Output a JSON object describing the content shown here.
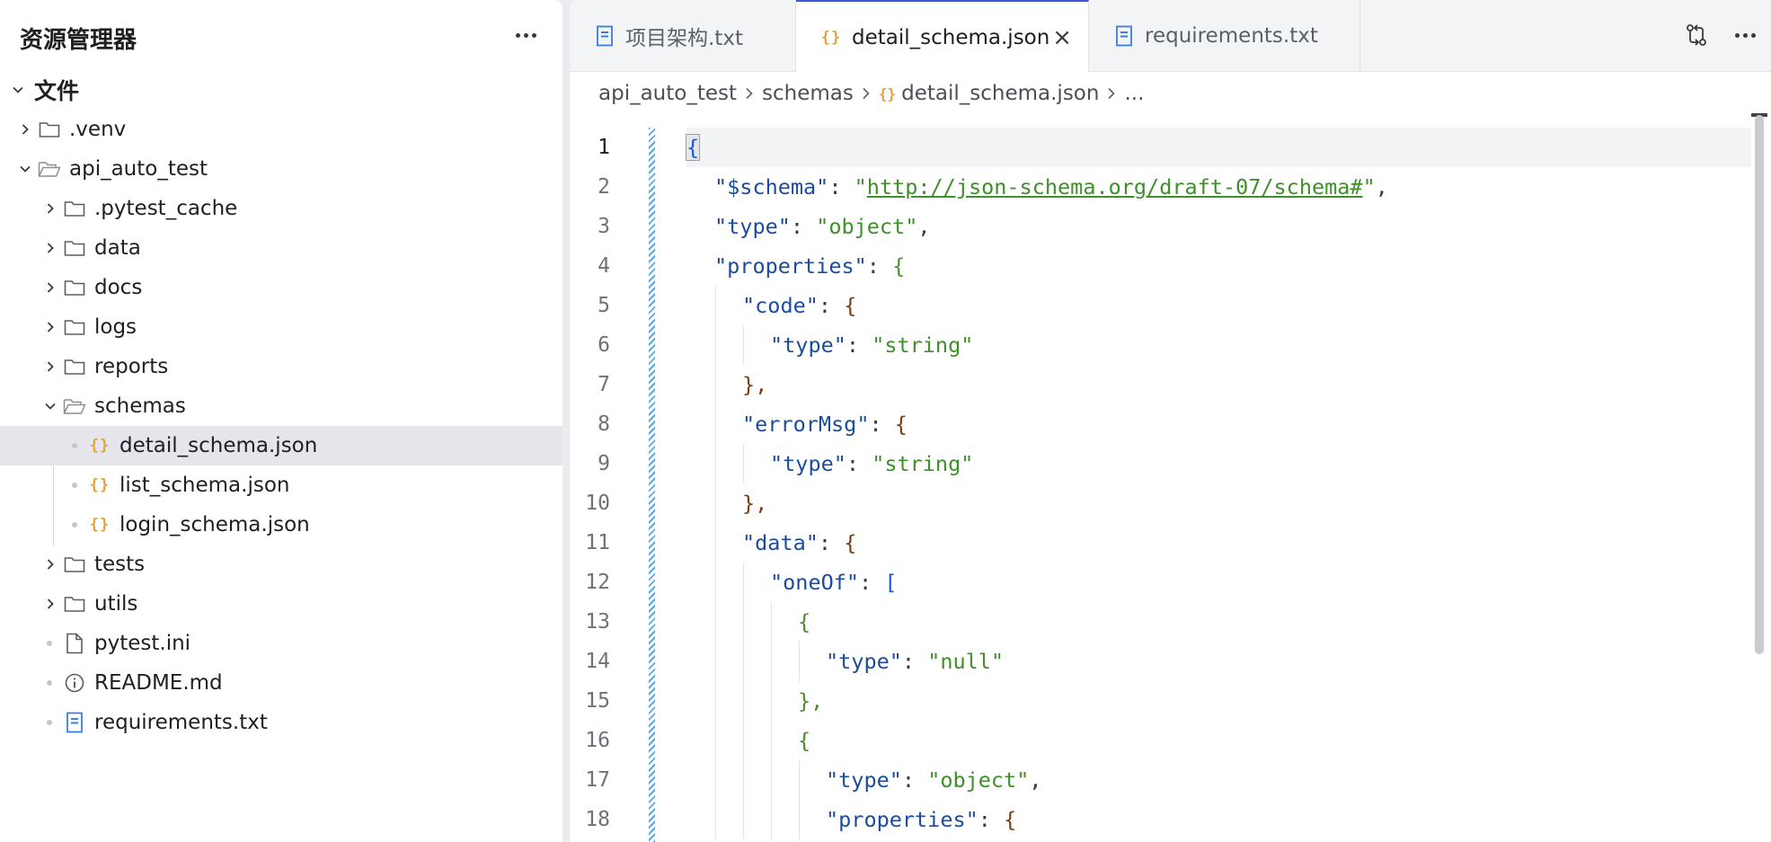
{
  "sidebar": {
    "title": "资源管理器",
    "root_label": "文件",
    "items": [
      {
        "label": ".venv",
        "type": "folder"
      },
      {
        "label": "api_auto_test",
        "type": "folder-open"
      },
      {
        "label": ".pytest_cache",
        "type": "folder"
      },
      {
        "label": "data",
        "type": "folder"
      },
      {
        "label": "docs",
        "type": "folder"
      },
      {
        "label": "logs",
        "type": "folder"
      },
      {
        "label": "reports",
        "type": "folder"
      },
      {
        "label": "schemas",
        "type": "folder-open"
      },
      {
        "label": "detail_schema.json",
        "type": "json",
        "selected": true
      },
      {
        "label": "list_schema.json",
        "type": "json"
      },
      {
        "label": "login_schema.json",
        "type": "json"
      },
      {
        "label": "tests",
        "type": "folder"
      },
      {
        "label": "utils",
        "type": "folder"
      },
      {
        "label": "pytest.ini",
        "type": "file"
      },
      {
        "label": "README.md",
        "type": "info"
      },
      {
        "label": "requirements.txt",
        "type": "text"
      }
    ]
  },
  "tabs": [
    {
      "label": "项目架构.txt",
      "icon": "text-file-icon"
    },
    {
      "label": "detail_schema.json",
      "icon": "json-file-icon",
      "active": true,
      "close": "×"
    },
    {
      "label": "requirements.txt",
      "icon": "text-file-icon"
    }
  ],
  "breadcrumb": {
    "parts": [
      "api_auto_test",
      "schemas",
      "detail_schema.json",
      "..."
    ],
    "json_icon": "{}"
  },
  "code_lines": [
    {
      "n": "1"
    },
    {
      "n": "2"
    },
    {
      "n": "3"
    },
    {
      "n": "4"
    },
    {
      "n": "5"
    },
    {
      "n": "6"
    },
    {
      "n": "7"
    },
    {
      "n": "8"
    },
    {
      "n": "9"
    },
    {
      "n": "10"
    },
    {
      "n": "11"
    },
    {
      "n": "12"
    },
    {
      "n": "13"
    },
    {
      "n": "14"
    },
    {
      "n": "15"
    },
    {
      "n": "16"
    },
    {
      "n": "17"
    },
    {
      "n": "18"
    }
  ],
  "code": {
    "l1_brace": "{",
    "l2_key": "\"$schema\"",
    "l2_val_q1": "\"",
    "l2_url": "http://json-schema.org/draft-07/schema#",
    "l2_val_q2": "\"",
    "l3_key": "\"type\"",
    "l3_val": "\"object\"",
    "l4_key": "\"properties\"",
    "l4_brace": "{",
    "l5_key": "\"code\"",
    "l5_brace": "{",
    "l6_key": "\"type\"",
    "l6_val": "\"string\"",
    "l7_close": "},",
    "l8_key": "\"errorMsg\"",
    "l8_brace": "{",
    "l9_key": "\"type\"",
    "l9_val": "\"string\"",
    "l10_close": "},",
    "l11_key": "\"data\"",
    "l11_brace": "{",
    "l12_key": "\"oneOf\"",
    "l12_bracket": "[",
    "l13_brace": "{",
    "l14_key": "\"type\"",
    "l14_val": "\"null\"",
    "l15_close": "},",
    "l16_brace": "{",
    "l17_key": "\"type\"",
    "l17_val": "\"object\"",
    "l18_key": "\"properties\"",
    "l18_brace": "{",
    "colon": ": ",
    "comma": ","
  },
  "colors": {
    "accent": "#3b5bdb",
    "json_icon": "#e6a23c",
    "key": "#1a4d9c",
    "string": "#3f8f2a"
  }
}
